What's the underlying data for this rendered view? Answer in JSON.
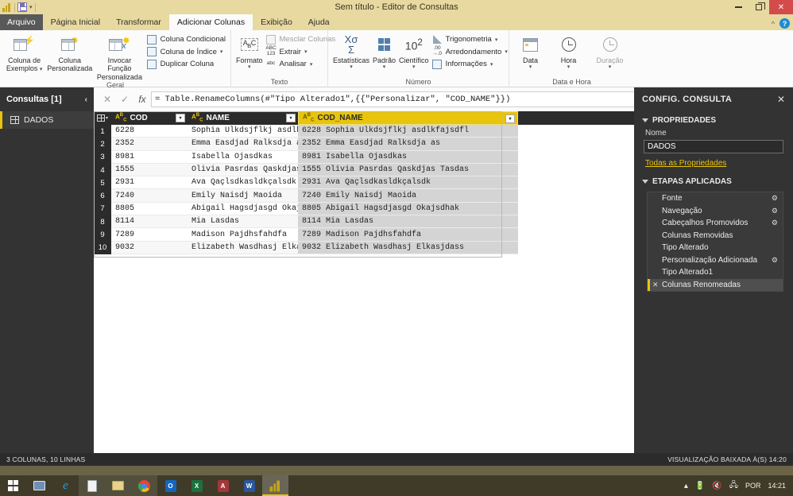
{
  "window": {
    "title": "Sem título - Editor de Consultas",
    "quick_access": {
      "app_icon": "powerbi-icon",
      "save_label": "Salvar",
      "dropdown": "▾"
    },
    "controls": {
      "minimize": "minimize-icon",
      "restore": "restore-icon",
      "close": "✕"
    },
    "ribbon_collapse": "^",
    "help": "?"
  },
  "tabs": [
    {
      "label": "Arquivo",
      "type": "file"
    },
    {
      "label": "Página Inicial",
      "type": "normal"
    },
    {
      "label": "Transformar",
      "type": "normal"
    },
    {
      "label": "Adicionar Colunas",
      "type": "active"
    },
    {
      "label": "Exibição",
      "type": "normal"
    },
    {
      "label": "Ajuda",
      "type": "normal"
    }
  ],
  "ribbon": {
    "groups": [
      {
        "label": "Geral",
        "big_buttons": [
          {
            "line1": "Coluna de",
            "line2": "Exemplos",
            "caret": true,
            "icon": "table-lightning-icon"
          },
          {
            "line1": "Coluna",
            "line2": "Personalizada",
            "caret": false,
            "icon": "table-star-icon"
          },
          {
            "line1": "Invocar Função",
            "line2": "Personalizada",
            "caret": false,
            "icon": "table-fx-icon"
          }
        ],
        "small_buttons": [
          {
            "label": "Coluna Condicional",
            "caret": false,
            "icon": "conditional-column-icon"
          },
          {
            "label": "Coluna de Índice",
            "caret": true,
            "icon": "index-column-icon"
          },
          {
            "label": "Duplicar Coluna",
            "caret": false,
            "icon": "duplicate-column-icon"
          }
        ]
      },
      {
        "label": "Texto",
        "big_buttons": [
          {
            "line1": "Formato",
            "line2": "",
            "caret": true,
            "icon": "format-abc-icon"
          }
        ],
        "small_buttons": [
          {
            "label": "Mesclar Colunas",
            "caret": false,
            "icon": "merge-columns-icon"
          },
          {
            "label": "Extrair",
            "caret": true,
            "icon": "extract-icon"
          },
          {
            "label": "Analisar",
            "caret": true,
            "icon": "parse-icon"
          }
        ]
      },
      {
        "label": "Número",
        "big_buttons": [
          {
            "line1": "Estatísticas",
            "line2": "",
            "caret": true,
            "icon": "statistics-icon"
          },
          {
            "line1": "Padrão",
            "line2": "",
            "caret": true,
            "icon": "standard-icon"
          },
          {
            "line1": "Científico",
            "line2": "",
            "caret": true,
            "icon": "scientific-icon"
          }
        ],
        "small_buttons": [
          {
            "label": "Trigonometria",
            "caret": true,
            "icon": "trigonometry-icon"
          },
          {
            "label": "Arredondamento",
            "caret": true,
            "icon": "rounding-icon"
          },
          {
            "label": "Informações",
            "caret": true,
            "icon": "information-icon"
          }
        ]
      },
      {
        "label": "Data e Hora",
        "big_buttons": [
          {
            "line1": "Data",
            "line2": "",
            "caret": true,
            "icon": "calendar-icon"
          },
          {
            "line1": "Hora",
            "line2": "",
            "caret": true,
            "icon": "clock-icon"
          },
          {
            "line1": "Duração",
            "line2": "",
            "caret": true,
            "icon": "duration-icon"
          }
        ],
        "small_buttons": []
      }
    ]
  },
  "formula_bar": {
    "cancel": "✕",
    "accept": "✓",
    "fx": "fx",
    "value": "= Table.RenameColumns(#\"Tipo Alterado1\",{{\"Personalizar\", \"COD_NAME\"}})",
    "expand": "⌄"
  },
  "queries_pane": {
    "title": "Consultas [1]",
    "collapse": "‹",
    "items": [
      {
        "label": "DADOS",
        "icon": "table-icon",
        "selected": true
      }
    ]
  },
  "grid": {
    "columns": [
      {
        "name": "COD",
        "type_icon": "text-type-icon",
        "selected": false
      },
      {
        "name": "NAME",
        "type_icon": "text-type-icon",
        "selected": false
      },
      {
        "name": "COD_NAME",
        "type_icon": "text-type-icon",
        "selected": true
      }
    ],
    "rows": [
      {
        "n": "1",
        "COD": "6228",
        "NAME": "Sophia Ulkdsjflkj asdlk…",
        "COD_NAME": "6228 Sophia Ulkdsjflkj asdlkfajsdfl"
      },
      {
        "n": "2",
        "COD": "2352",
        "NAME": "Emma Easdjad Ralksdja a…",
        "COD_NAME": "2352 Emma Easdjad Ralksdja as"
      },
      {
        "n": "3",
        "COD": "8981",
        "NAME": "Isabella Ojasdkas",
        "COD_NAME": "8981 Isabella Ojasdkas"
      },
      {
        "n": "4",
        "COD": "1555",
        "NAME": "Olivia Pasrdas Qaskdjas…",
        "COD_NAME": "1555 Olivia Pasrdas Qaskdjas Tasdas"
      },
      {
        "n": "5",
        "COD": "2931",
        "NAME": "Ava Qaçlsdkasldkçalsdk",
        "COD_NAME": "2931 Ava Qaçlsdkasldkçalsdk"
      },
      {
        "n": "6",
        "COD": "7240",
        "NAME": "Emily Naisdj Maoida",
        "COD_NAME": "7240 Emily Naisdj Maoida"
      },
      {
        "n": "7",
        "COD": "8805",
        "NAME": "Abigail Hagsdjasgd Okaj…",
        "COD_NAME": "8805 Abigail Hagsdjasgd Okajsdhak"
      },
      {
        "n": "8",
        "COD": "8114",
        "NAME": "Mia Lasdas",
        "COD_NAME": "8114 Mia Lasdas"
      },
      {
        "n": "9",
        "COD": "7289",
        "NAME": "Madison Pajdhsfahdfa",
        "COD_NAME": "7289 Madison Pajdhsfahdfa"
      },
      {
        "n": "10",
        "COD": "9032",
        "NAME": "Elizabeth Wasdhasj Elka…",
        "COD_NAME": "9032 Elizabeth Wasdhasj Elkasjdass"
      }
    ]
  },
  "settings_pane": {
    "title": "CONFIG. CONSULTA",
    "close": "✕",
    "properties": {
      "section": "PROPRIEDADES",
      "name_label": "Nome",
      "name_value": "DADOS",
      "all_properties_link": "Todas as Propriedades"
    },
    "applied_steps": {
      "section": "ETAPAS APLICADAS",
      "steps": [
        {
          "label": "Fonte",
          "gear": true,
          "active": false
        },
        {
          "label": "Navegação",
          "gear": true,
          "active": false
        },
        {
          "label": "Cabeçalhos Promovidos",
          "gear": true,
          "active": false
        },
        {
          "label": "Colunas Removidas",
          "gear": false,
          "active": false
        },
        {
          "label": "Tipo Alterado",
          "gear": false,
          "active": false
        },
        {
          "label": "Personalização Adicionada",
          "gear": true,
          "active": false
        },
        {
          "label": "Tipo Alterado1",
          "gear": false,
          "active": false
        },
        {
          "label": "Colunas Renomeadas",
          "gear": false,
          "active": true
        }
      ]
    }
  },
  "status_bar": {
    "left": "3 COLUNAS, 10 LINHAS",
    "right": "VISUALIZAÇÃO BAIXADA À(S) 14:20"
  },
  "taskbar": {
    "items": [
      {
        "name": "start-button",
        "icon": "windows-icon"
      },
      {
        "name": "task-view",
        "icon": "monitor-icon"
      },
      {
        "name": "internet-explorer",
        "icon": "ie-icon"
      },
      {
        "name": "notepad",
        "icon": "notepad-icon"
      },
      {
        "name": "file-explorer",
        "icon": "folder-icon"
      },
      {
        "name": "chrome",
        "icon": "chrome-icon"
      },
      {
        "name": "outlook",
        "icon": "outlook-icon",
        "letter": "O"
      },
      {
        "name": "excel",
        "icon": "excel-icon",
        "letter": "X"
      },
      {
        "name": "access",
        "icon": "access-icon",
        "letter": "A"
      },
      {
        "name": "word",
        "icon": "word-icon",
        "letter": "W"
      },
      {
        "name": "power-bi",
        "icon": "powerbi-icon",
        "active": true
      }
    ],
    "tray": {
      "expand": "▴",
      "battery": "battery-icon",
      "volume": "volume-muted-icon",
      "network": "network-icon",
      "language": "POR",
      "clock": "14:21"
    }
  },
  "colors": {
    "brand_yellow": "#e8c40c",
    "titlebar": "#e7d9a0",
    "dark_panel": "#333333",
    "grid_header": "#2b2b2b",
    "close_red": "#d44b4b"
  }
}
